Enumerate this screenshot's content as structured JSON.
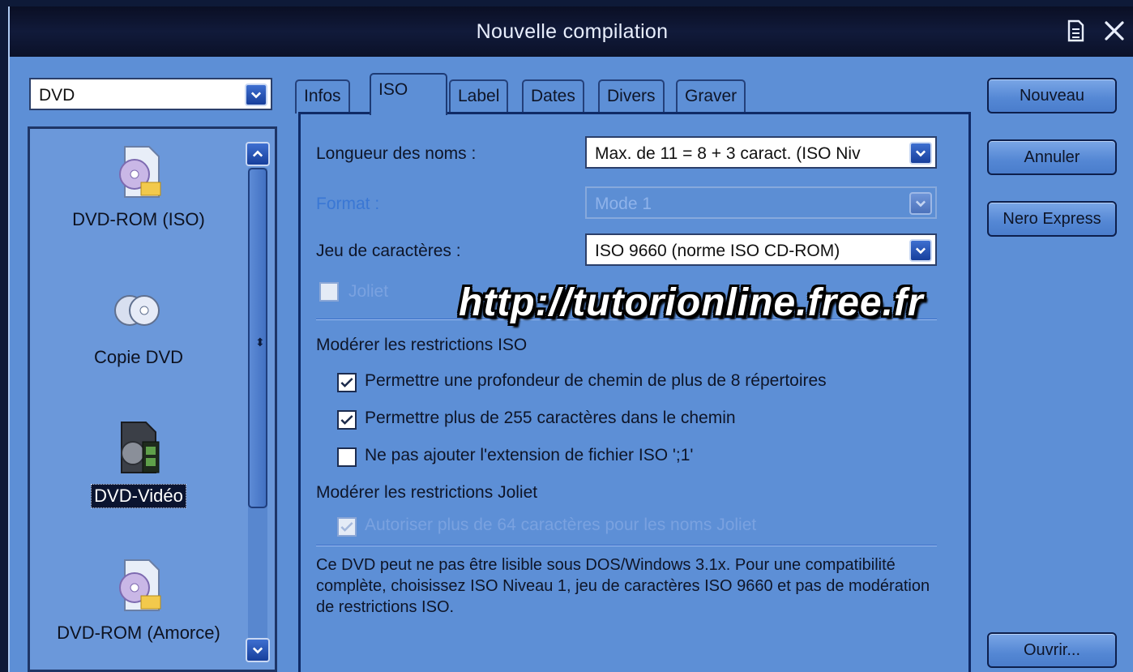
{
  "window": {
    "title": "Nouvelle compilation",
    "icons": [
      "document-icon",
      "close-icon"
    ]
  },
  "media_combo": {
    "value": "DVD"
  },
  "compilation_types": [
    {
      "label": "DVD-ROM (ISO)",
      "icon": "dvd-document-icon",
      "selected": false
    },
    {
      "label": "Copie DVD",
      "icon": "disc-copy-icon",
      "selected": false
    },
    {
      "label": "DVD-Vidéo",
      "icon": "dvd-video-icon",
      "selected": true
    },
    {
      "label": "DVD-ROM (Amorce)",
      "icon": "dvd-boot-icon",
      "selected": false
    }
  ],
  "tabs": [
    {
      "label": "Infos",
      "active": false
    },
    {
      "label": "ISO",
      "active": true
    },
    {
      "label": "Label",
      "active": false
    },
    {
      "label": "Dates",
      "active": false
    },
    {
      "label": "Divers",
      "active": false
    },
    {
      "label": "Graver",
      "active": false
    }
  ],
  "iso": {
    "name_length": {
      "label": "Longueur des noms :",
      "value": "Max. de 11 = 8 + 3 caract. (ISO Niv"
    },
    "format": {
      "label": "Format :",
      "value": "Mode 1",
      "disabled": true
    },
    "charset": {
      "label": "Jeu de caractères :",
      "value": "ISO 9660 (norme ISO CD-ROM)"
    },
    "joliet": {
      "label": "Joliet",
      "checked": false,
      "disabled": true
    },
    "iso_restrictions": {
      "title": "Modérer les restrictions ISO",
      "options": [
        {
          "label": "Permettre une profondeur de chemin de plus de 8 répertoires",
          "checked": true
        },
        {
          "label": "Permettre plus de 255 caractères dans le chemin",
          "checked": true
        },
        {
          "label": "Ne pas ajouter l'extension de fichier ISO ';1'",
          "checked": false
        }
      ]
    },
    "joliet_restrictions": {
      "title": "Modérer les restrictions Joliet",
      "options": [
        {
          "label": "Autoriser plus de 64 caractères pour les noms Joliet",
          "checked": true,
          "disabled": true
        }
      ]
    },
    "note": "Ce DVD peut ne pas être lisible sous DOS/Windows 3.1x. Pour une compatibilité complète, choisissez ISO Niveau 1, jeu de caractères ISO 9660 et pas de modération de restrictions ISO."
  },
  "buttons": {
    "new": "Nouveau",
    "cancel": "Annuler",
    "nero_express": "Nero Express",
    "open": "Ouvrir..."
  },
  "watermark": "http://tutorionline.free.fr"
}
